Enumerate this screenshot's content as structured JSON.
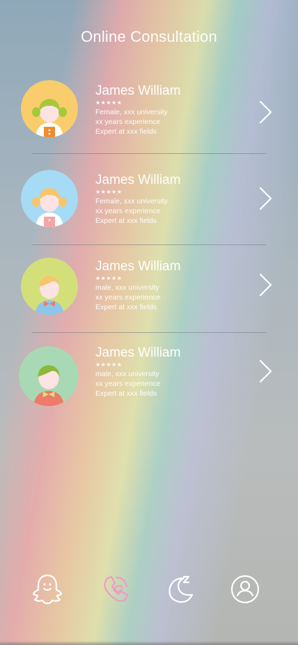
{
  "header": {
    "title": "Online Consultation"
  },
  "consultants": [
    {
      "name": "James William",
      "stars": "★★★★★",
      "line1": "Female, xxx university",
      "line2": "xx years experience",
      "line3": "Expert at xxx fields",
      "avatar_bg": "#f9cd6b",
      "avatar_icon": "girl-pigtails-orange-icon"
    },
    {
      "name": "James William",
      "stars": "★★★★★",
      "line1": "Female, xxx university",
      "line2": "xx years experience",
      "line3": "Expert at xxx fields",
      "avatar_bg": "#a6dbf5",
      "avatar_icon": "girl-pigtails-pink-icon"
    },
    {
      "name": "James William",
      "stars": "★★★★★",
      "line1": "male, xxx university",
      "line2": "xx years experience",
      "line3": "Expert at xxx fields",
      "avatar_bg": "#d3e07a",
      "avatar_icon": "boy-bowtie-blue-icon"
    },
    {
      "name": "James William",
      "stars": "★★★★★",
      "line1": "male, xxx university",
      "line2": "xx years experience",
      "line3": "Expert at xxx fields",
      "avatar_bg": "#a8d9b4",
      "avatar_icon": "boy-bowtie-red-icon"
    }
  ],
  "tabbar": {
    "items": [
      {
        "icon": "ghost-icon",
        "active": false
      },
      {
        "icon": "phone-icon",
        "active": true
      },
      {
        "icon": "moon-sleep-icon",
        "active": false
      },
      {
        "icon": "user-profile-icon",
        "active": false
      }
    ],
    "active_color": "#f29ac4",
    "inactive_color": "#ffffff"
  }
}
